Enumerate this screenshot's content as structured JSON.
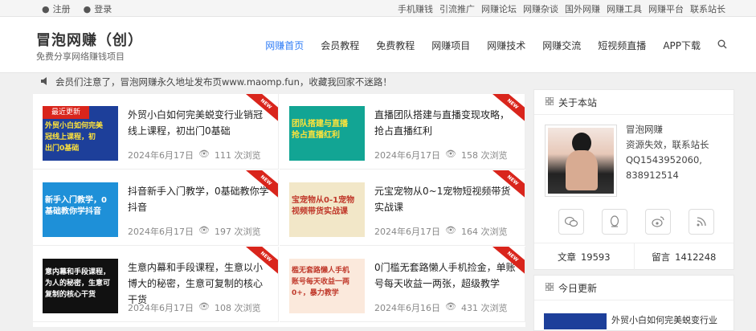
{
  "topbar": {
    "register": "注册",
    "login": "登录",
    "links": [
      "手机赚钱",
      "引流推广",
      "网赚论坛",
      "网赚杂谈",
      "国外网赚",
      "网赚工具",
      "网赚平台",
      "联系站长"
    ]
  },
  "header": {
    "site_title": "冒泡网赚（创）",
    "site_subtitle": "免费分享网络赚钱项目",
    "nav": [
      "网赚首页",
      "会员教程",
      "免费教程",
      "网赚项目",
      "网赚技术",
      "网赚交流",
      "短视频直播",
      "APP下载"
    ]
  },
  "notice": "会员们注意了，冒泡网赚永久地址发布页www.maomp.fun，收藏我回家不迷路！",
  "posts": [
    {
      "badge": "最近更新",
      "thumb_text": "外贸小白如何完美\n冠线上课程，初\n出门0基础",
      "title": "外贸小白如何完美蜕变行业销冠线上课程，初出门0基础",
      "date": "2024年6月17日",
      "views": "111 次浏览",
      "ribbon": "NEW",
      "thumb_bg": "#1d3f9a",
      "thumb_fg": "#ffe33a"
    },
    {
      "badge": "",
      "thumb_text": "团队搭建与直播\n抢占直播红利",
      "title": "直播团队搭建与直播变现攻略，抢占直播红利",
      "date": "2024年6月17日",
      "views": "158 次浏览",
      "ribbon": "NEW",
      "thumb_bg": "#12a594",
      "thumb_fg": "#ffe33a"
    },
    {
      "badge": "",
      "thumb_text": "新手入门教学，0\n基础教你学抖音",
      "title": "抖音新手入门教学，0基础教你学抖音",
      "date": "2024年6月17日",
      "views": "197 次浏览",
      "ribbon": "NEW",
      "thumb_bg": "#1e90d8",
      "thumb_fg": "#ffffff"
    },
    {
      "badge": "",
      "thumb_text": "宝宠物从0-1宠物\n视频带货实战课",
      "title": "元宝宠物从0~1宠物短视频带货实战课",
      "date": "2024年6月17日",
      "views": "164 次浏览",
      "ribbon": "NEW",
      "thumb_bg": "#f2e7c8",
      "thumb_fg": "#c0392b"
    },
    {
      "badge": "",
      "thumb_text": "意内幕和手段课程，\n为人的秘密，生意可\n复制的核心干货",
      "title": "生意内幕和手段课程，生意以小博大的秘密，生意可复制的核心干货",
      "date": "2024年6月17日",
      "views": "108 次浏览",
      "ribbon": "NEW",
      "thumb_bg": "#111111",
      "thumb_fg": "#ffffff"
    },
    {
      "badge": "",
      "thumb_text": "槛无套路懒人手机\n账号每天收益一两\n0+，暴力教学",
      "title": "0门槛无套路懒人手机捡金，单账号每天收益一两张，超级教学",
      "date": "2024年6月16日",
      "views": "431 次浏览",
      "ribbon": "NEW",
      "thumb_bg": "#fbe9dc",
      "thumb_fg": "#c0392b"
    }
  ],
  "sidebar": {
    "about_title": "关于本站",
    "name": "冒泡网赚",
    "line1": "资源失效，联系站长",
    "line2": "QQ1543952060,",
    "line3": "838912514",
    "articles_label": "文章",
    "articles_count": "19593",
    "comments_label": "留言",
    "comments_count": "1412248",
    "today_title": "今日更新",
    "today_first": "外贸小白如何完美蜕变行业"
  }
}
